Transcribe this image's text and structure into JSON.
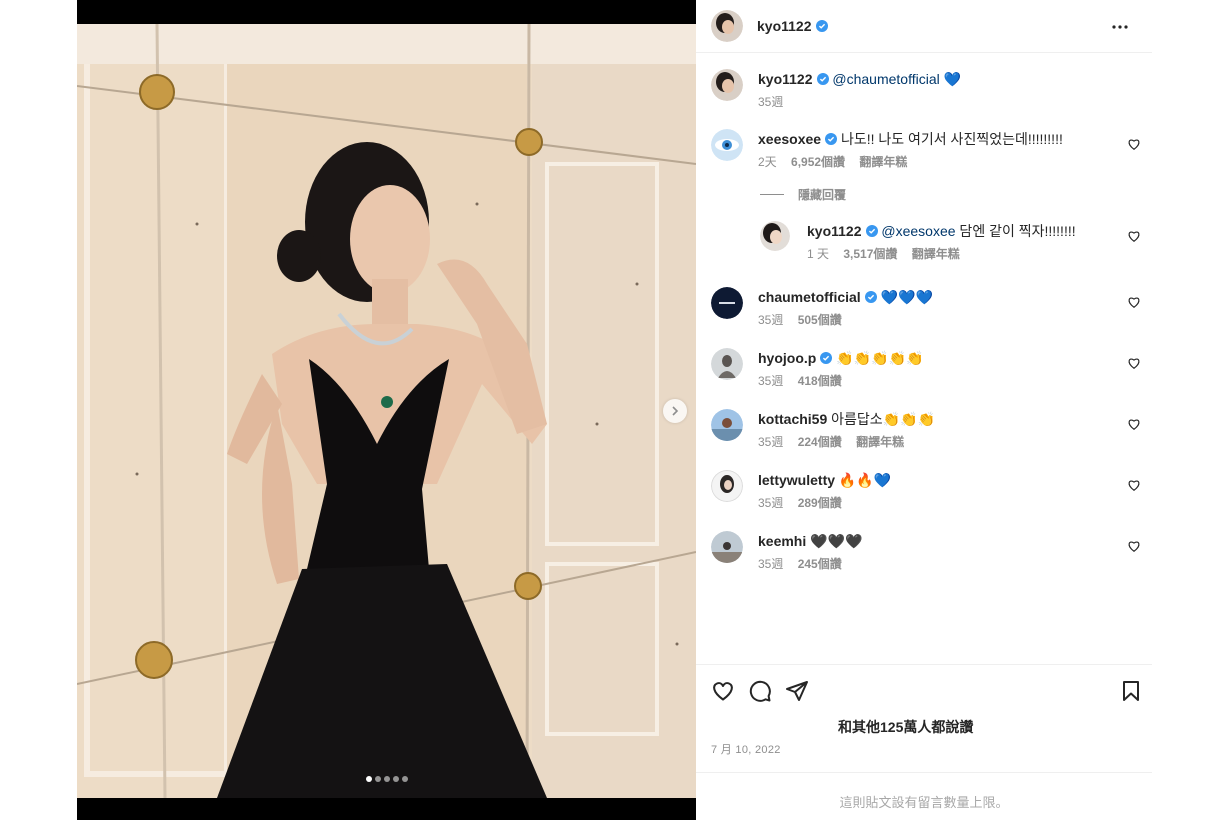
{
  "post": {
    "author": "kyo1122",
    "caption_mention": "@chaumetofficial",
    "caption_emoji": "💙",
    "caption_time": "35週",
    "carousel_count": 5,
    "carousel_active": 1
  },
  "comments": [
    {
      "user": "xeesoxee",
      "verified": true,
      "text": "나도!! 나도 여기서 사진찍었는데!!!!!!!!!",
      "time": "2天",
      "likes": "6,952個讚",
      "translate": "翻譯年糕"
    },
    {
      "user": "chaumetofficial",
      "verified": true,
      "text": "💙💙💙",
      "time": "35週",
      "likes": "505個讚"
    },
    {
      "user": "hyojoo.p",
      "verified": true,
      "text": "👏👏👏👏👏",
      "time": "35週",
      "likes": "418個讚"
    },
    {
      "user": "kottachi59",
      "verified": false,
      "text": "아름답소👏👏👏",
      "time": "35週",
      "likes": "224個讚",
      "translate": "翻譯年糕"
    },
    {
      "user": "lettywuletty",
      "verified": false,
      "text": "🔥🔥💙",
      "time": "35週",
      "likes": "289個讚"
    },
    {
      "user": "keemhi",
      "verified": false,
      "text": "🖤🖤🖤",
      "time": "35週",
      "likes": "245個讚"
    }
  ],
  "hide_replies": "隱藏回覆",
  "reply": {
    "user": "kyo1122",
    "verified": true,
    "mention": "@xeesoxee",
    "text": " 담엔 같이 찍자!!!!!!!!",
    "time": "1 天",
    "likes": "3,517個讚",
    "translate": "翻譯年糕"
  },
  "footer": {
    "liked_by": "和其他125萬人都說讚",
    "date": "7 月 10, 2022",
    "comments_closed": "這則貼文設有留言數量上限。"
  },
  "icons": [
    "verified-badge-icon",
    "more-icon",
    "heart-icon",
    "comment-icon",
    "share-icon",
    "save-icon",
    "chevron-right-icon"
  ],
  "colors": {
    "verified": "#3897f0",
    "mention": "#00376b",
    "muted": "#8e8e8e"
  }
}
